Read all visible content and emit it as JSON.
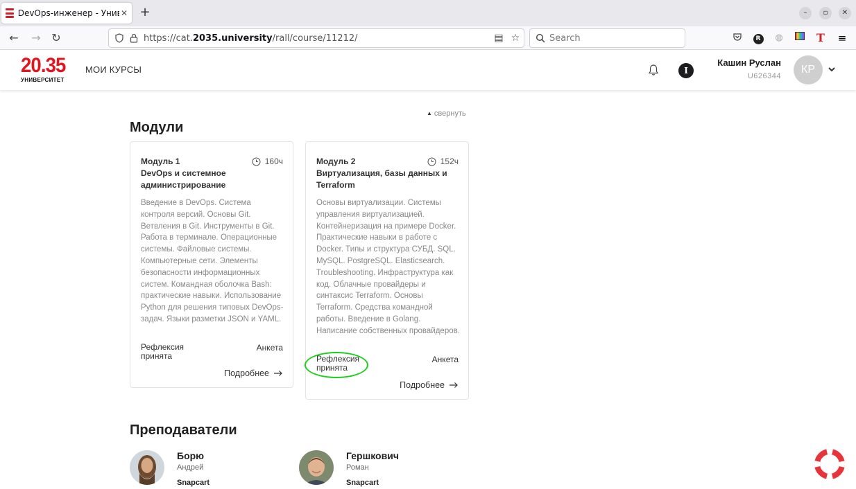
{
  "browser": {
    "tab_title": "DevOps-инженер - Униве",
    "url_prefix": "https://cat.",
    "url_domain": "2035.university",
    "url_path": "/rall/course/11212/",
    "search_placeholder": "Search"
  },
  "header": {
    "logo_number": "20.35",
    "logo_sub": "УНИВЕРСИТЕТ",
    "nav_my_courses": "МОИ КУРСЫ",
    "info_letter": "I",
    "user_name": "Кашин Руслан",
    "user_id": "U626344",
    "avatar_initials": "КР"
  },
  "content": {
    "collapse_label": "свернуть",
    "modules_heading": "Модули",
    "modules": [
      {
        "name": "Модуль 1",
        "hours": "160ч",
        "title": "DevOps и системное администрирование",
        "description": "Введение в DevOps. Система контроля версий. Основы Git. Ветвления в Git. Инструменты в Git. Работа в терминале. Операционные системы. Файловые системы. Компьютерные сети. Элементы безопасности информационных систем. Командная оболочка Bash: практические навыки. Использование Python для решения типовых DevOps-задач. Языки разметки JSON и YAML.",
        "reflection": "Рефлексия принята",
        "survey": "Анкета",
        "more": "Подробнее"
      },
      {
        "name": "Модуль 2",
        "hours": "152ч",
        "title": "Виртуализация, базы данных и Terraform",
        "description": "Основы виртуализации. Системы управления виртуализацией. Контейнеризация на примере Docker. Практические навыки в работе с Docker. Типы и структура СУБД. SQL. MySQL. PostgreSQL. Elasticsearch. Troubleshooting. Инфраструктура как код. Облачные провайдеры и синтаксис Terraform. Основы Terraform. Средства командной работы. Введение в Golang. Написание собственных провайдеров.",
        "reflection": "Рефлексия принята",
        "survey": "Анкета",
        "more": "Подробнее"
      }
    ],
    "teachers_heading": "Преподаватели",
    "teachers": [
      {
        "last_name": "Борю",
        "first_name": "Андрей",
        "org": "Snapcart"
      },
      {
        "last_name": "Гершкович",
        "first_name": "Роман",
        "org": "Snapcart"
      }
    ]
  },
  "colors": {
    "brand_red": "#e1161e",
    "highlight_green": "#19d019",
    "help_red": "#e8333a"
  }
}
